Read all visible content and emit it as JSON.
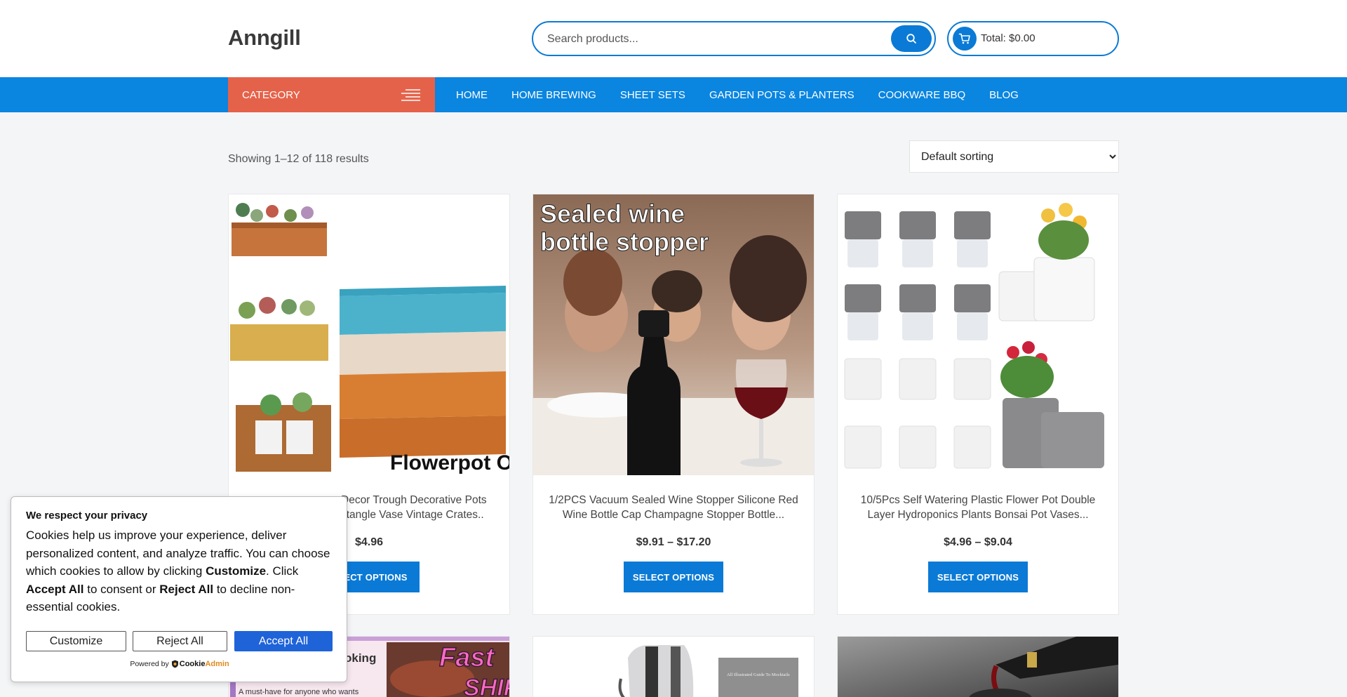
{
  "header": {
    "logo": "Anngill",
    "search_placeholder": "Search products...",
    "cart_total": "Total: $0.00"
  },
  "nav": {
    "category_label": "CATEGORY",
    "links": [
      "HOME",
      "HOME BREWING",
      "SHEET SETS",
      "GARDEN POTS & PLANTERS",
      "COOKWARE BBQ",
      "BLOG"
    ]
  },
  "shop": {
    "results_count": "Showing 1–12 of 118 results",
    "sort_selected": "Default sorting"
  },
  "products": [
    {
      "title_line1": "Decor Trough Decorative Pots",
      "title_line2": "ctangle Vase Vintage Crates..",
      "price": "$4.96",
      "button": "ELECT OPTIONS",
      "image_caption": "Flowerpot Only"
    },
    {
      "title_line1": "1/2PCS Vacuum Sealed Wine Stopper Silicone Red",
      "title_line2": "Wine Bottle Cap Champagne Stopper Bottle...",
      "price": "$9.91 – $17.20",
      "button": "SELECT OPTIONS",
      "image_caption_1": "Sealed wine",
      "image_caption_2": "bottle stopper"
    },
    {
      "title_line1": "10/5Pcs Self Watering Plastic Flower Pot Double",
      "title_line2": "Layer Hydroponics Plants Bonsai Pot Vases...",
      "price": "$4.96 – $9.04",
      "button": "SELECT OPTIONS"
    }
  ],
  "row2": {
    "card1_heading": "oking",
    "card1_sub": "A must-have for anyone who wants",
    "card1_badge_1": "Fast",
    "card1_badge_2": "SHIP",
    "card2_book": "All Illustrated Guide To Mocktails"
  },
  "cookie": {
    "title": "We respect your privacy",
    "text_1": "Cookies help us improve your experience, deliver personalized content, and analyze traffic. You can choose which cookies to allow by clicking ",
    "text_customize": "Customize",
    "text_2": ". Click ",
    "text_accept": "Accept All",
    "text_3": " to consent or ",
    "text_reject": "Reject All",
    "text_4": " to decline non-essential cookies.",
    "btn_customize": "Customize",
    "btn_reject": "Reject All",
    "btn_accept": "Accept All",
    "powered_by": "Powered by",
    "brand_1": "Cookie",
    "brand_2": "Admin"
  },
  "colors": {
    "primary_blue": "#0a7ad6",
    "nav_blue": "#0a85e0",
    "category_orange": "#e5624a",
    "accept_blue": "#1f63d9"
  }
}
